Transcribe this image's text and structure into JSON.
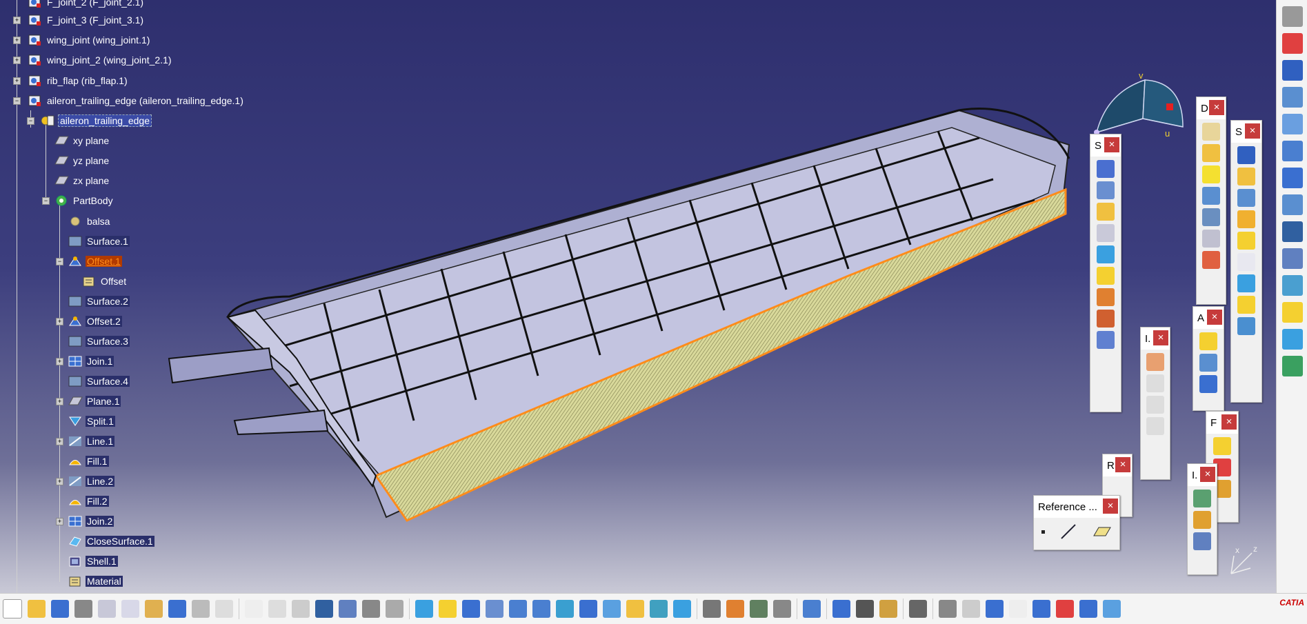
{
  "tree": {
    "items": [
      {
        "label": "F_joint_2 (F_joint_2.1)",
        "level": 0
      },
      {
        "label": "F_joint_3 (F_joint_3.1)",
        "level": 0
      },
      {
        "label": "wing_joint (wing_joint.1)",
        "level": 0
      },
      {
        "label": "wing_joint_2 (wing_joint_2.1)",
        "level": 0
      },
      {
        "label": "rib_flap (rib_flap.1)",
        "level": 0
      },
      {
        "label": "aileron_trailing_edge (aileron_trailing_edge.1)",
        "level": 0
      },
      {
        "label": "aileron_trailing_edge",
        "level": 1
      },
      {
        "label": "xy plane",
        "level": 2
      },
      {
        "label": "yz plane",
        "level": 2
      },
      {
        "label": "zx plane",
        "level": 2
      },
      {
        "label": "PartBody",
        "level": 2
      },
      {
        "label": "balsa",
        "level": 3
      },
      {
        "label": "Surface.1",
        "level": 3
      },
      {
        "label": "Offset.1",
        "level": 3
      },
      {
        "label": "Offset",
        "level": 4
      },
      {
        "label": "Surface.2",
        "level": 3
      },
      {
        "label": "Offset.2",
        "level": 3
      },
      {
        "label": "Surface.3",
        "level": 3
      },
      {
        "label": "Join.1",
        "level": 3
      },
      {
        "label": "Surface.4",
        "level": 3
      },
      {
        "label": "Plane.1",
        "level": 3
      },
      {
        "label": "Split.1",
        "level": 3
      },
      {
        "label": "Line.1",
        "level": 3
      },
      {
        "label": "Fill.1",
        "level": 3
      },
      {
        "label": "Line.2",
        "level": 3
      },
      {
        "label": "Fill.2",
        "level": 3
      },
      {
        "label": "Join.2",
        "level": 3
      },
      {
        "label": "CloseSurface.1",
        "level": 3
      },
      {
        "label": "Shell.1",
        "level": 3
      },
      {
        "label": "Material",
        "level": 3
      }
    ]
  },
  "compass": {
    "axis_v": "v",
    "axis_u": "u"
  },
  "palettes": [
    {
      "title": "S"
    },
    {
      "title": "D"
    },
    {
      "title": "S"
    },
    {
      "title": "I."
    },
    {
      "title": "A"
    },
    {
      "title": "R"
    },
    {
      "title": "F"
    },
    {
      "title": "I."
    },
    {
      "title": "Reference ..."
    }
  ],
  "axis_triad": {
    "z": "z",
    "x": "x"
  },
  "logo": {
    "text": "CATIA"
  },
  "colors": {
    "background_top": "#2e2f6e",
    "background_bottom": "#c9c9d6",
    "selection": "#ff8c1a",
    "surface_fill": "#d8d89a",
    "part": "#b9bad8"
  }
}
